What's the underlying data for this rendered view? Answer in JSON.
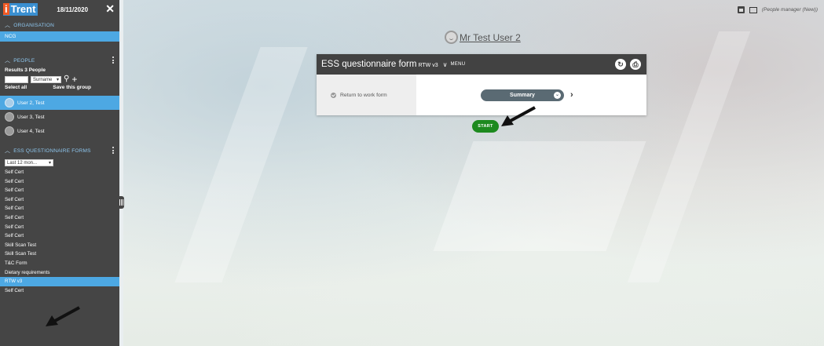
{
  "app": {
    "logo_prefix": "i",
    "logo_name": "Trent",
    "date": "18/11/2020",
    "role": "(People manager (New))"
  },
  "sidebar": {
    "organisation": {
      "label": "ORGANISATION",
      "items": [
        "NCG"
      ]
    },
    "people": {
      "label": "PEOPLE",
      "results": "Results 3 People",
      "sort_value": "Surname",
      "select_all": "Select all",
      "save_group": "Save this group",
      "persons": [
        "User 2, Test",
        "User 3, Test",
        "User 4, Test"
      ]
    },
    "forms": {
      "label": "ESS QUESTIONNAIRE FORMS",
      "period": "Last 12 mon...",
      "items": [
        "Self Cert",
        "Self Cert",
        "Self Cert",
        "Self Cert",
        "Self Cert",
        "Self Cert",
        "Self Cert",
        "Self Cert",
        "Skill Scan Test",
        "Skill Scan Test",
        "T&C Form",
        "Dietary requirements",
        "RTW v3",
        "Self Cert"
      ],
      "active_item": "RTW v3"
    }
  },
  "main": {
    "user_name": "Mr Test User 2",
    "card": {
      "title": "ESS questionnaire form",
      "version": "RTW v3",
      "menu_label": "MENU",
      "section_label": "Return to work form",
      "summary_label": "Summary"
    },
    "start_label": "START"
  },
  "colors": {
    "accent_blue": "#4da8e3",
    "sidebar_bg": "#454545",
    "start_green": "#1d8a1f",
    "logo_orange": "#f15a24"
  }
}
